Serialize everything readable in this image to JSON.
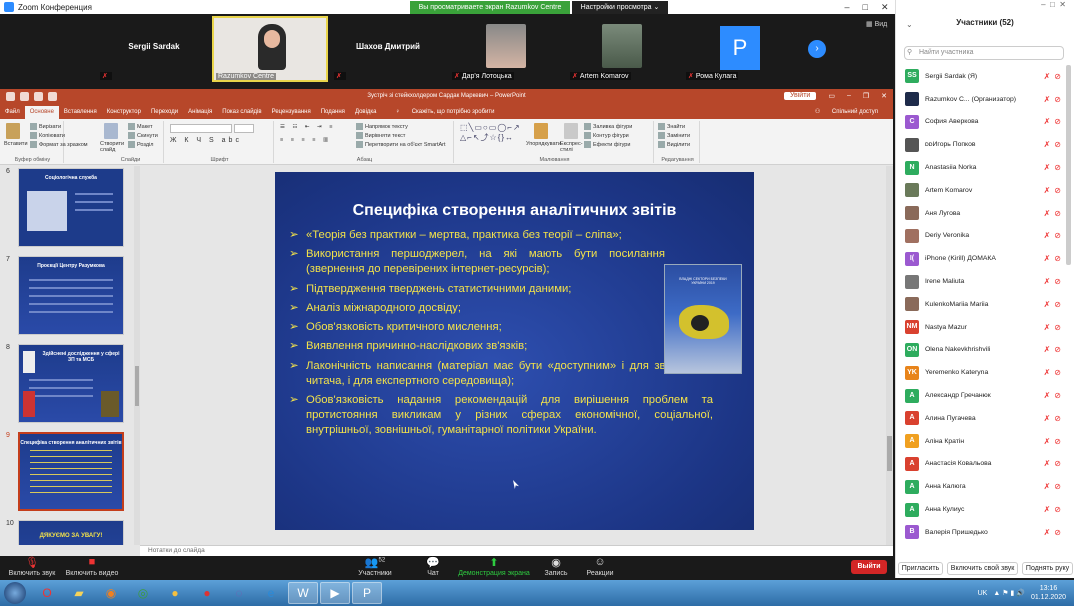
{
  "window": {
    "title": "Zoom Конференция",
    "sharing_banner": "Вы просматриваете экран Razumkov Centre",
    "view_options": "Настройки просмотра ⌄",
    "view_button": "Вид"
  },
  "gallery": {
    "tiles": [
      {
        "name": "Sergii Sardak",
        "label": ""
      },
      {
        "name": "",
        "label": "Razumkov Centre"
      },
      {
        "name": "Шахов Дмитрий",
        "label": ""
      },
      {
        "name": "",
        "label": "Дар'я Лотоцька"
      },
      {
        "name": "",
        "label": "Artem Komarov"
      },
      {
        "name": "P",
        "label": "Рома Кулага"
      }
    ]
  },
  "powerpoint": {
    "title": "Зустріч зі стейкхолдером Сардак Маркевич  –  PowerPoint",
    "signin": "Увійти",
    "tabs": [
      "Файл",
      "Основне",
      "Вставлення",
      "Конструктор",
      "Переходи",
      "Анімація",
      "Показ слайдів",
      "Рецензування",
      "Подання",
      "Довідка"
    ],
    "tell_me": "Скажіть, що потрібно зробити",
    "share": "Спільний доступ",
    "ribbon": {
      "clipboard": {
        "label": "Буфер обміну",
        "paste": "Вставити",
        "cut": "Вирізати",
        "copy": "Копіювати",
        "format_painter": "Формат за зразком"
      },
      "slides": {
        "label": "Слайди",
        "new_slide": "Створити слайд",
        "layout": "Макет",
        "reset": "Скинути",
        "section": "Розділ"
      },
      "font": {
        "label": "Шрифт"
      },
      "paragraph": {
        "label": "Абзац",
        "text_direction": "Напрямок тексту",
        "align_text": "Вирівняти текст",
        "smartart": "Перетворити на об'єкт SmartArt"
      },
      "drawing": {
        "label": "Малювання",
        "arrange": "Упорядкувати",
        "quick_styles": "Експрес-стилі",
        "shape_fill": "Заливка фігури",
        "shape_outline": "Контур фігури",
        "shape_effects": "Ефекти фігури"
      },
      "editing": {
        "label": "Редагування",
        "find": "Знайти",
        "replace": "Замінити",
        "select": "Виділити"
      }
    },
    "thumbnails": [
      {
        "num": "6",
        "title": "Соціологічна служба"
      },
      {
        "num": "7",
        "title": "Проєкції Центру Разумкова"
      },
      {
        "num": "8",
        "title": "Здійснені дослідження у сфері ЗП та МСБ"
      },
      {
        "num": "9",
        "title": "Специфіка створення аналітичних звітів"
      },
      {
        "num": "10",
        "title": "ДЯКУЄМО ЗА УВАГУ!"
      }
    ],
    "slide": {
      "heading": "Специфіка створення аналітичних звітів",
      "bullets": [
        "«Теорія без практики – мертва, практика без теорії – сліпа»;",
        "Використання першоджерел, на які мають бути посилання (звернення до перевірених інтернет-ресурсів);",
        "Підтвердження тверджень статистичними даними;",
        "Аналіз міжнародного досвіду;",
        "Обов'язковість критичного мислення;",
        "Виявлення причинно-наслідкових зв'язків;",
        "Лаконічність написання (матеріал має бути «доступним» і для звичайного читача, і для експертного середовища);",
        "Обов'язковість надання рекомендацій для вирішення проблем та протистояння викликам у різних сферах економічної, соціальної, внутрішньої, зовнішньої, гуманітарної політики України."
      ],
      "book_title": "ВЛАДНІ СЕКТОРИ БЕЗПЕКИ УКРАЇНИ 2019"
    },
    "notes": "Нотатки до слайда"
  },
  "participants": {
    "header": "Участники (52)",
    "search_placeholder": "Найти участника",
    "list": [
      {
        "initials": "SS",
        "color": "#2eac5e",
        "name": "Sergii Sardak (Я)"
      },
      {
        "initials": "",
        "color": "#1e2b4a",
        "name": "Razumkov C... (Организатор)"
      },
      {
        "initials": "С",
        "color": "#9b59d0",
        "name": "София Аверкова"
      },
      {
        "initials": "",
        "color": "#555555",
        "name": "ᴅᴅИгорь Попков"
      },
      {
        "initials": "N",
        "color": "#2eac5e",
        "name": "Anastasiia Norka"
      },
      {
        "initials": "",
        "color": "#6a7a5a",
        "name": "Artem Komarov"
      },
      {
        "initials": "",
        "color": "#8a6a5a",
        "name": "Аня Лугова"
      },
      {
        "initials": "",
        "color": "#a07060",
        "name": "Deriy Veronika"
      },
      {
        "initials": "I(",
        "color": "#9b59d0",
        "name": "iPhone (Kirill) ДОМАКА"
      },
      {
        "initials": "",
        "color": "#777777",
        "name": "Irene Maliuta"
      },
      {
        "initials": "",
        "color": "#8a6a5a",
        "name": "KulenkoMariia Mariia"
      },
      {
        "initials": "NM",
        "color": "#d9412f",
        "name": "Nastya Mazur"
      },
      {
        "initials": "ON",
        "color": "#2eac5e",
        "name": "Olena Nakevkhrishvili"
      },
      {
        "initials": "YK",
        "color": "#e8841a",
        "name": "Yeremenko Kateryna"
      },
      {
        "initials": "А",
        "color": "#2eac5e",
        "name": "Александр Гречанюк"
      },
      {
        "initials": "А",
        "color": "#d9412f",
        "name": "Алина Пугачева"
      },
      {
        "initials": "А",
        "color": "#f0a020",
        "name": "Аліна Кратін"
      },
      {
        "initials": "А",
        "color": "#d9412f",
        "name": "Анастасія Ковальова"
      },
      {
        "initials": "А",
        "color": "#2eac5e",
        "name": "Анна Калюга"
      },
      {
        "initials": "А",
        "color": "#2eac5e",
        "name": "Анна Кулиус"
      },
      {
        "initials": "В",
        "color": "#9b59d0",
        "name": "Валерія Пришедько"
      }
    ],
    "footer": {
      "raise_hand_others": "Пригласить",
      "unmute": "Включить свой звук",
      "raise_hand": "Поднять руку"
    }
  },
  "controls": {
    "unmute": "Включить звук",
    "start_video": "Включить видео",
    "participants": "Участники",
    "participants_count": "52",
    "chat": "Чат",
    "share_screen": "Демонстрация экрана",
    "record": "Запись",
    "reactions": "Реакции",
    "leave": "Выйти"
  },
  "taskbar": {
    "lang": "UK",
    "time": "13:16",
    "date": "01.12.2020"
  }
}
